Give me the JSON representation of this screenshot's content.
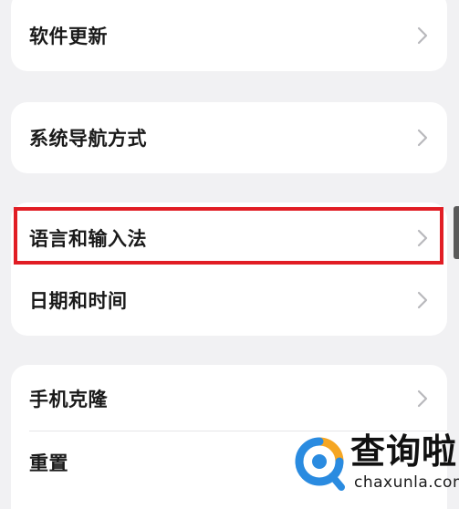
{
  "settings": {
    "items": [
      {
        "label": "软件更新"
      },
      {
        "label": "系统导航方式"
      },
      {
        "label": "语言和输入法"
      },
      {
        "label": "日期和时间"
      },
      {
        "label": "手机克隆"
      },
      {
        "label": "重置"
      }
    ]
  },
  "highlight": {
    "target": "语言和输入法",
    "color": "#e11d24"
  },
  "watermark": {
    "name": "查询啦",
    "domain": "chaxunla.com",
    "brand_colors": [
      "#f5a623",
      "#2a8be0"
    ]
  },
  "icons": {
    "chevron": "chevron-right-icon"
  }
}
